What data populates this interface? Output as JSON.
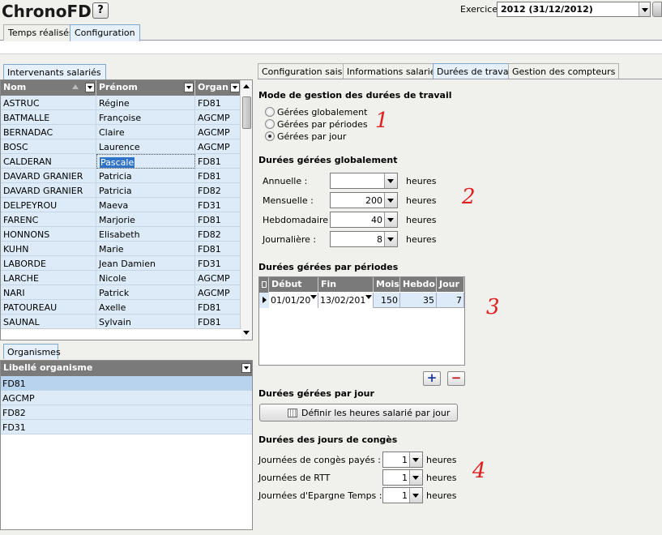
{
  "app": {
    "title": "ChronoFD",
    "help_label": "?"
  },
  "exercice": {
    "label": "Exercice",
    "value": "2012  (31/12/2012)"
  },
  "main_tabs": [
    {
      "label": "Temps réalisés",
      "active": false
    },
    {
      "label": "Configuration",
      "active": true
    }
  ],
  "left_panel": {
    "tab_label": "Intervenants salariés",
    "columns": [
      "Nom",
      "Prénom",
      "Organ"
    ],
    "rows": [
      [
        "ASTRUC",
        "Régine",
        "FD81"
      ],
      [
        "BATMALLE",
        "Françoise",
        "AGCMP"
      ],
      [
        "BERNADAC",
        "Claire",
        "AGCMP"
      ],
      [
        "BOSC",
        "Laurence",
        "AGCMP"
      ],
      [
        "CALDERAN",
        "Pascale",
        "FD81"
      ],
      [
        "DAVARD GRANIER",
        "Patricia",
        "FD81"
      ],
      [
        "DAVARD GRANIER",
        "Patricia",
        "FD82"
      ],
      [
        "DELPEYROU",
        "Maeva",
        "FD31"
      ],
      [
        "FARENC",
        "Marjorie",
        "FD81"
      ],
      [
        "HONNONS",
        "Elisabeth",
        "FD82"
      ],
      [
        "KUHN",
        "Marie",
        "FD81"
      ],
      [
        "LABORDE",
        "Jean Damien",
        "FD31"
      ],
      [
        "LARCHE",
        "Nicole",
        "AGCMP"
      ],
      [
        "NARI",
        "Patrick",
        "AGCMP"
      ],
      [
        "PATOUREAU",
        "Axelle",
        "FD81"
      ],
      [
        "SAUNAL",
        "Sylvain",
        "FD81"
      ]
    ],
    "selected_row": 4
  },
  "org_panel": {
    "tab_label": "Organismes",
    "column": "Libellé organisme",
    "rows": [
      "FD81",
      "AGCMP",
      "FD82",
      "FD31"
    ],
    "selected_row": 0
  },
  "right_tabs": [
    {
      "label": "Configuration saisie",
      "active": false
    },
    {
      "label": "Informations salariés",
      "active": false
    },
    {
      "label": "Durées de travail",
      "active": true
    },
    {
      "label": "Gestion des compteurs",
      "active": false
    }
  ],
  "mode": {
    "title": "Mode de gestion des durées de travail",
    "options": [
      "Gérées globalement",
      "Gérées par périodes",
      "Gérées par jour"
    ],
    "selected": 2
  },
  "global": {
    "title": "Durées gérées globalement",
    "fields": [
      {
        "label": "Annuelle :",
        "value": "",
        "unit": "heures"
      },
      {
        "label": "Mensuelle :",
        "value": "200",
        "unit": "heures"
      },
      {
        "label": "Hebdomadaire :",
        "value": "40",
        "unit": "heures"
      },
      {
        "label": "Journalière :",
        "value": "8",
        "unit": "heures"
      }
    ]
  },
  "periods": {
    "title": "Durées gérées par périodes",
    "columns": [
      "Début",
      "Fin",
      "Mois",
      "Hebdo",
      "Jour"
    ],
    "rows": [
      [
        "01/01/20",
        "13/02/201",
        "150",
        "35",
        "7"
      ]
    ],
    "add_label": "+",
    "remove_label": "−"
  },
  "per_day": {
    "title": "Durées gérées par jour",
    "button_label": "Définir les heures salarié par jour"
  },
  "leave": {
    "title": "Durées des jours de congès",
    "fields": [
      {
        "label": "Journées de congès payés :",
        "value": "1",
        "unit": "heures"
      },
      {
        "label": "Journées de RTT",
        "value": "1",
        "unit": "heures"
      },
      {
        "label": "Journées d'Epargne Temps  :",
        "value": "1",
        "unit": "heures"
      }
    ]
  },
  "annotations": [
    "1",
    "2",
    "3",
    "4"
  ],
  "colors": {
    "grid_row": "#dcebf7",
    "header": "#7a7a7a",
    "selection": "#2f74c6",
    "annotation": "#e02020"
  }
}
